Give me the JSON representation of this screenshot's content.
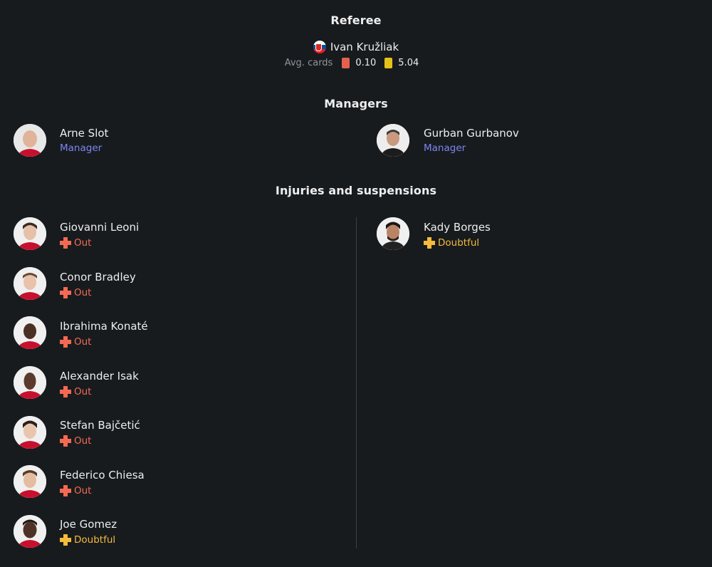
{
  "referee": {
    "title": "Referee",
    "name": "Ivan Kružliak",
    "flag_icon": "slovakia-flag-icon",
    "avg_cards_label": "Avg. cards",
    "red_cards": "0.10",
    "yellow_cards": "5.04"
  },
  "managers": {
    "title": "Managers",
    "home": {
      "name": "Arne Slot",
      "role": "Manager"
    },
    "away": {
      "name": "Gurban Gurbanov",
      "role": "Manager"
    }
  },
  "injuries": {
    "title": "Injuries and suspensions",
    "home": [
      {
        "name": "Giovanni Leoni",
        "status": "Out"
      },
      {
        "name": "Conor Bradley",
        "status": "Out"
      },
      {
        "name": "Ibrahima Konaté",
        "status": "Out"
      },
      {
        "name": "Alexander Isak",
        "status": "Out"
      },
      {
        "name": "Stefan Bajčetić",
        "status": "Out"
      },
      {
        "name": "Federico Chiesa",
        "status": "Out"
      },
      {
        "name": "Joe Gomez",
        "status": "Doubtful"
      }
    ],
    "away": [
      {
        "name": "Kady Borges",
        "status": "Doubtful"
      }
    ]
  },
  "colors": {
    "background": "#181b1e",
    "role_text": "#7d85f2",
    "out": "#f36a52",
    "doubtful": "#f4bb3c",
    "red_card": "#e5614e",
    "yellow_card": "#e4c21a"
  }
}
